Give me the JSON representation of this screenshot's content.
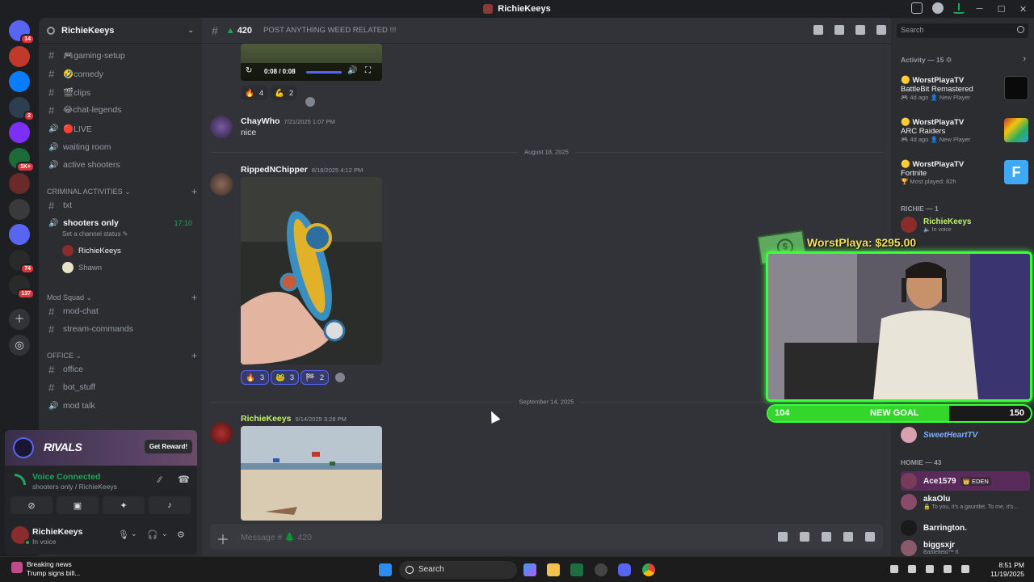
{
  "window": {
    "title": "RichieKeeys"
  },
  "rail": {
    "servers": [
      {
        "badge": "14",
        "color": "#5865f2"
      },
      {
        "badge": "",
        "color": "#c0392b"
      },
      {
        "badge": "",
        "color": "#0a7cff"
      },
      {
        "badge": "2",
        "color": "#2c3e50"
      },
      {
        "badge": "",
        "color": "#7b2ff7"
      },
      {
        "badge": "1K+",
        "color": "#1e6b3a"
      },
      {
        "badge": "",
        "color": "#6b2a2a"
      },
      {
        "badge": "",
        "color": "#3a3a3a"
      },
      {
        "badge": "",
        "color": "#5865f2"
      },
      {
        "badge": "74",
        "color": "#2a2a2a"
      },
      {
        "badge": "137",
        "color": "#2a2a2a"
      }
    ]
  },
  "sidebar": {
    "server_name": "RichieKeeys",
    "channels": [
      {
        "name": "🎮gaming-setup",
        "type": "text"
      },
      {
        "name": "🤣comedy",
        "type": "text"
      },
      {
        "name": "🎬clips",
        "type": "text"
      },
      {
        "name": "😂chat-legends",
        "type": "text"
      },
      {
        "name": "🔴LIVE",
        "type": "voice"
      },
      {
        "name": "waiting room",
        "type": "voice"
      },
      {
        "name": "active shooters",
        "type": "voice"
      }
    ],
    "categories": {
      "criminal": "CRIMINAL ACTIVITIES",
      "mod": "Mod Squad",
      "office": "OFFICE"
    },
    "criminal_channels": [
      {
        "name": "txt",
        "type": "text"
      },
      {
        "name": "shooters only",
        "type": "voice",
        "time": "17:10"
      }
    ],
    "channel_status": "Set a channel status",
    "voice_users": [
      "RichieKeeys",
      "Shawn"
    ],
    "mod_channels": [
      "mod-chat",
      "stream-commands"
    ],
    "office_channels": [
      {
        "name": "office",
        "type": "text"
      },
      {
        "name": "bot_stuff",
        "type": "text"
      },
      {
        "name": "mod talk",
        "type": "voice"
      }
    ]
  },
  "promo": {
    "title": "RIVALS",
    "button": "Get Reward!"
  },
  "voice": {
    "status": "Voice Connected",
    "location": "shooters only / RichieKeeys"
  },
  "user": {
    "name": "RichieKeeys",
    "status": "In voice"
  },
  "chat": {
    "channel": "420",
    "topic": "POST ANYTHING WEED RELATED !!!",
    "video": {
      "time": "0:08 / 0:08"
    },
    "reactions_top": [
      {
        "emoji": "🔥",
        "count": "4"
      },
      {
        "emoji": "💪",
        "count": "2"
      }
    ],
    "messages": [
      {
        "author": "ChayWho",
        "time": "7/21/2025 1:07 PM",
        "text": "nice"
      },
      {
        "author": "RippedNChipper",
        "time": "8/18/2025 4:12 PM"
      },
      {
        "author": "RichieKeeys",
        "time": "9/14/2025 3:28 PM"
      }
    ],
    "dividers": [
      "August 18, 2025",
      "September 14, 2025"
    ],
    "reactions_mid": [
      {
        "emoji": "🔥",
        "count": "3"
      },
      {
        "emoji": "🐸",
        "count": "3"
      },
      {
        "emoji": "🏁",
        "count": "2"
      }
    ],
    "composer_placeholder": "Message # 🌲 420"
  },
  "rpanel": {
    "search_placeholder": "Search",
    "activity_title": "Activity — 15 ⚙",
    "activities": [
      {
        "user": "WorstPlayaTV",
        "game": "BattleBit Remastered",
        "meta": "🎮 4d ago  👤 New Player",
        "thumb": "#111"
      },
      {
        "user": "WorstPlayaTV",
        "game": "ARC Raiders",
        "meta": "🎮 4d ago  👤 New Player",
        "thumb": "#2b2b2b"
      },
      {
        "user": "WorstPlayaTV",
        "game": "Fortnite",
        "meta": "🏆 Most played: 82h",
        "thumb": "#3fa9f5"
      }
    ],
    "richie_title": "RICHIE — 1",
    "richie_member": {
      "name": "RichieKeeys",
      "sub": "🔈 In voice"
    },
    "hidden_member": {
      "name": "SweetHeartTV"
    },
    "homie_title": "HOMIE — 43",
    "homies": [
      {
        "name": "Ace1579",
        "tag": "👑 EDEN",
        "sub": ""
      },
      {
        "name": "akaOlu",
        "sub": "🔒 To you, it's a gauntlet. To me, it's..."
      },
      {
        "name": "Barrington.",
        "sub": ""
      },
      {
        "name": "biggsxjr",
        "sub": "Battlefield™ 6"
      }
    ]
  },
  "overlay": {
    "donation": "WorstPlaya: $295.00",
    "goal_left": "104",
    "goal_label": "NEW GOAL",
    "goal_right": "150",
    "goal_progress": 0.69
  },
  "taskbar": {
    "news_title": "Breaking news",
    "news_sub": "Trump signs bill...",
    "search": "Search",
    "time": "8:51 PM",
    "date": "11/19/2025"
  }
}
